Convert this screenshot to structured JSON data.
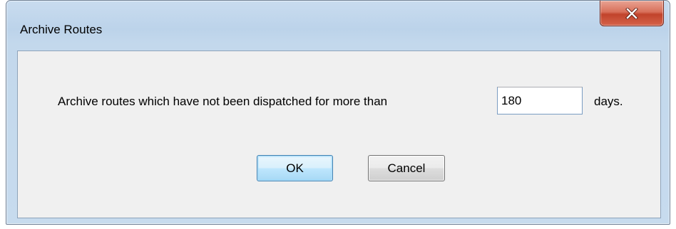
{
  "window": {
    "title": "Archive Routes"
  },
  "icons": {
    "close": "close-icon"
  },
  "colors": {
    "title_bar": "#bcd3ea",
    "close_button": "#c1432b",
    "client_background": "#f0f0f0",
    "default_button_border": "#3c7fb1"
  },
  "dialog": {
    "message": "Archive routes which have not been dispatched for more than",
    "days_value": "180",
    "days_suffix": "days."
  },
  "buttons": {
    "ok_label": "OK",
    "cancel_label": "Cancel"
  }
}
